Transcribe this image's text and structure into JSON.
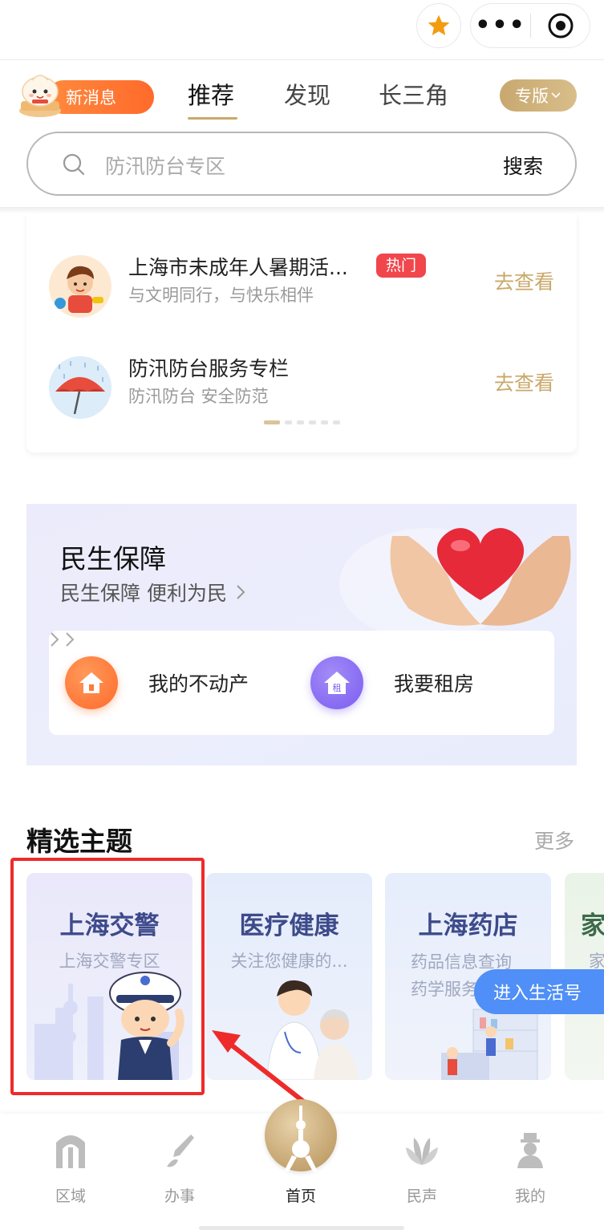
{
  "capsule": {
    "star_icon": "star-icon",
    "more_label": "•••",
    "target_icon": "record-target-icon"
  },
  "header": {
    "new_message": "新消息",
    "tabs": [
      {
        "label": "推荐",
        "active": true
      },
      {
        "label": "发现",
        "active": false
      },
      {
        "label": "长三角",
        "active": false
      }
    ],
    "edition_button": "专版"
  },
  "search": {
    "placeholder": "防汛防台专区",
    "button": "搜索"
  },
  "list": {
    "items": [
      {
        "title": "上海市未成年人暑期活...",
        "badge": "热门",
        "subtitle": "与文明同行，与快乐相伴",
        "action": "去查看"
      },
      {
        "title": "防汛防台服务专栏",
        "subtitle": "防汛防台 安全防范",
        "action": "去查看"
      }
    ],
    "page_count": 6,
    "active_page": 1
  },
  "minsheng": {
    "title": "民生保障",
    "subtitle": "民生保障 便利为民",
    "quick": [
      {
        "label": "我的不动产",
        "icon": "house-icon"
      },
      {
        "label": "我要租房",
        "icon": "rent-house-icon",
        "badge": "租"
      }
    ]
  },
  "featured": {
    "title": "精选主题",
    "more": "更多",
    "cards": [
      {
        "title": "上海交警",
        "subtitle": "上海交警专区"
      },
      {
        "title": "医疗健康",
        "subtitle": "关注您健康的..."
      },
      {
        "title": "上海药店",
        "subtitle_lines": [
          "药品信息查询",
          "药学服务"
        ]
      },
      {
        "title": "家",
        "subtitle": "家"
      }
    ],
    "enter_button": "进入生活号"
  },
  "nav": {
    "items": [
      {
        "label": "区域",
        "icon": "region-gate-icon"
      },
      {
        "label": "办事",
        "icon": "pen-nib-icon"
      },
      {
        "label": "首页",
        "icon": "oriental-pearl-tower-icon",
        "active": true
      },
      {
        "label": "民声",
        "icon": "magnolia-flower-icon"
      },
      {
        "label": "我的",
        "icon": "user-icon"
      }
    ]
  },
  "colors": {
    "gold": "#c9a86a",
    "hot_red": "#f0464c",
    "highlight_red": "#ee2b2b",
    "blue_button": "#4f8ff7",
    "orange": "#ff7a35"
  }
}
